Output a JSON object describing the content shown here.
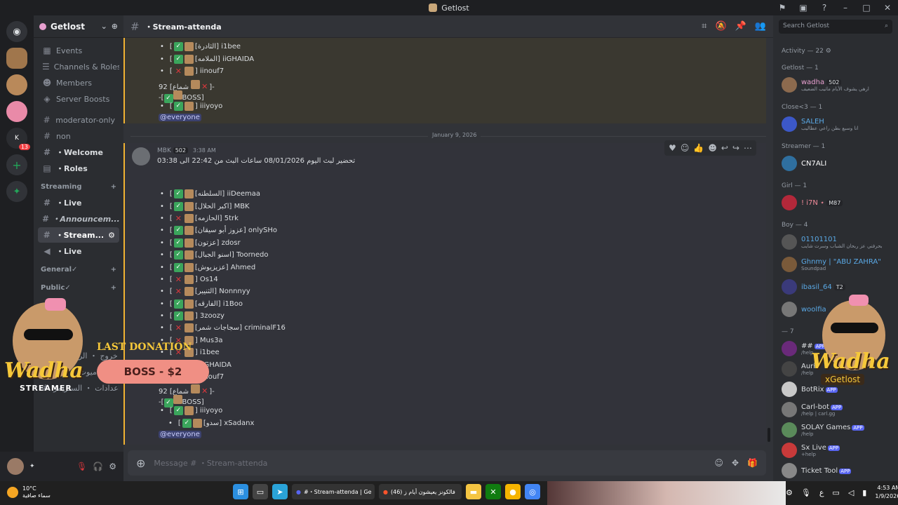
{
  "titlebar": {
    "title": "Getlost"
  },
  "server": {
    "name": "Getlost"
  },
  "sidebar": {
    "channels_top": [
      {
        "label": "Events",
        "icon": "calendar-icon"
      },
      {
        "label": "Channels & Roles",
        "icon": "list-icon"
      },
      {
        "label": "Members",
        "icon": "members-icon"
      },
      {
        "label": "Server Boosts",
        "icon": "boost-icon"
      }
    ],
    "channels": [
      {
        "label": "moderator-only"
      },
      {
        "label": "non"
      },
      {
        "label": "・Welcome"
      },
      {
        "label": "・Roles"
      }
    ],
    "cat_streaming": "Streaming",
    "streaming_channels": [
      {
        "label": "・Live"
      },
      {
        "label": "・Announcem..."
      },
      {
        "label": "・Stream..."
      },
      {
        "label": "・Live"
      }
    ],
    "cat_general": "General✓",
    "cat_public": "Public✓",
    "extra_channels": [
      {
        "label": "・خروج ・ الرومات"
      },
      {
        "label": "الثابم ・ ميوت ・ دفن"
      },
      {
        "label": "اعدادات ・ الستريمر"
      }
    ]
  },
  "channel": {
    "name": "・Stream-attenda",
    "composer_placeholder": "Message # ・Stream-attenda"
  },
  "msg1": {
    "rows": [
      {
        "s1": "ok",
        "name": "[الثادرة] i1bee"
      },
      {
        "s1": "ok",
        "name": "[الملامه] iiGHAIDA"
      },
      {
        "s1": "x",
        "name": "] iinouf7"
      }
    ],
    "line_a": "92 [شماع",
    "line_b": "BOSS]",
    "row_last": "] iiiyoyo",
    "mention": "@everyone"
  },
  "date_divider": "January 9, 2026",
  "msg2": {
    "author": "MBK",
    "tag": "502",
    "time": "3:38 AM",
    "text": "تحضير لبث اليوم 08/01/2026 ساعات البث من 22:42 الى 03:38",
    "rows": [
      {
        "s": "ok",
        "name": "[السلطنه] iiDeemaa"
      },
      {
        "s": "ok",
        "name": "[اكبر الحلال] MBK"
      },
      {
        "s": "x",
        "name": "[الحازمه] 5trk"
      },
      {
        "s": "ok",
        "name": "[عزوز أبو سيقان] onlySHo"
      },
      {
        "s": "ok",
        "name": "[عزتون] zdosr"
      },
      {
        "s": "ok",
        "name": "[اسنو الجبال] Toornedo"
      },
      {
        "s": "ok",
        "name": "[عزيزيوش] Ahmed"
      },
      {
        "s": "x",
        "name": "] Os14"
      },
      {
        "s": "x",
        "name": "[الثنيبر] Nonnnyy"
      },
      {
        "s": "ok",
        "name": "[الفارقه] i1Boo"
      },
      {
        "s": "ok",
        "name": "] 3zoozy"
      },
      {
        "s": "x",
        "name": "[سجاجات شمر] criminalF16"
      },
      {
        "s": "x",
        "name": "] Mus3a"
      },
      {
        "s": "x",
        "name": "] i1bee"
      },
      {
        "s": "ok",
        "name": "] iiGHAIDA"
      },
      {
        "s": "x",
        "name": "] iinouf7"
      }
    ],
    "line_a": "92 [شماع",
    "line_b": "BOSS]",
    "row_yoyo": "] iiiyoyo",
    "row_sub": "[سدو] xSadanx",
    "mention": "@everyone"
  },
  "members": {
    "search_placeholder": "Search Getlost",
    "activity": "Activity — 22",
    "groups": [
      {
        "title": "Getlost — 1",
        "members": [
          {
            "name": "wadha",
            "sub": "ارهي يشوف الأيام ماتيب الضعيف",
            "color": "#e8a0d0",
            "badge": "502"
          }
        ]
      },
      {
        "title": "Close<3 — 1",
        "members": [
          {
            "name": "SALEH",
            "sub": "انا وسبع بطن راعي عطاليب",
            "color": "#5aa9e6"
          }
        ]
      },
      {
        "title": "Streamer — 1",
        "members": [
          {
            "name": "CN7ALI",
            "sub": "",
            "color": "#ffffff"
          }
        ]
      },
      {
        "title": "Girl — 1",
        "members": [
          {
            "name": "! i7N ⋆",
            "sub": "",
            "color": "#f28b9a",
            "badge": "M87"
          }
        ]
      },
      {
        "title": "Boy — 4",
        "members": [
          {
            "name": "01101101",
            "sub": "بحرفني عز ربحان الشباب وسرت شايب",
            "color": "#5aa9e6"
          },
          {
            "name": "Ghnmy | \"ABU ZAHRA\"",
            "sub": "Soundpad",
            "color": "#5aa9e6"
          },
          {
            "name": "ibasil_64",
            "sub": "",
            "color": "#5aa9e6",
            "badge": "T2"
          },
          {
            "name": "woolfia",
            "sub": "",
            "color": "#5aa9e6"
          }
        ]
      },
      {
        "title": "— 7",
        "members": [
          {
            "name": "##",
            "sub": "/help",
            "color": "#dbdee1",
            "app": "APP"
          },
          {
            "name": "Auri",
            "sub": "/help",
            "color": "#dbdee1"
          },
          {
            "name": "BotRix",
            "sub": "",
            "color": "#dbdee1",
            "app": "APP"
          },
          {
            "name": "Carl-bot",
            "sub": "/help | carl.gg",
            "color": "#dbdee1",
            "app": "APP"
          },
          {
            "name": "SOLAY Games",
            "sub": "/help",
            "color": "#dbdee1",
            "app": "APP"
          },
          {
            "name": "Sx Live",
            "sub": "+help",
            "color": "#dbdee1",
            "app": "APP"
          },
          {
            "name": "Ticket Tool",
            "sub": "",
            "color": "#dbdee1",
            "app": "APP"
          }
        ]
      }
    ]
  },
  "overlay": {
    "name": "Wadha",
    "role": "STREAMER",
    "last_donation": "LAST DONATION",
    "donation": "BOSS - $2",
    "right_name": "Wadha",
    "right_sub": "xGetlost"
  },
  "taskbar": {
    "temp": "10°C",
    "weather": "سماء صافية",
    "discord_task": "#・Stream-attenda | Ge",
    "brave_task": "(46) فالكونز يعيشون أيام ز",
    "time": "4:53 AM",
    "date": "1/9/2026",
    "lang": "ع"
  }
}
